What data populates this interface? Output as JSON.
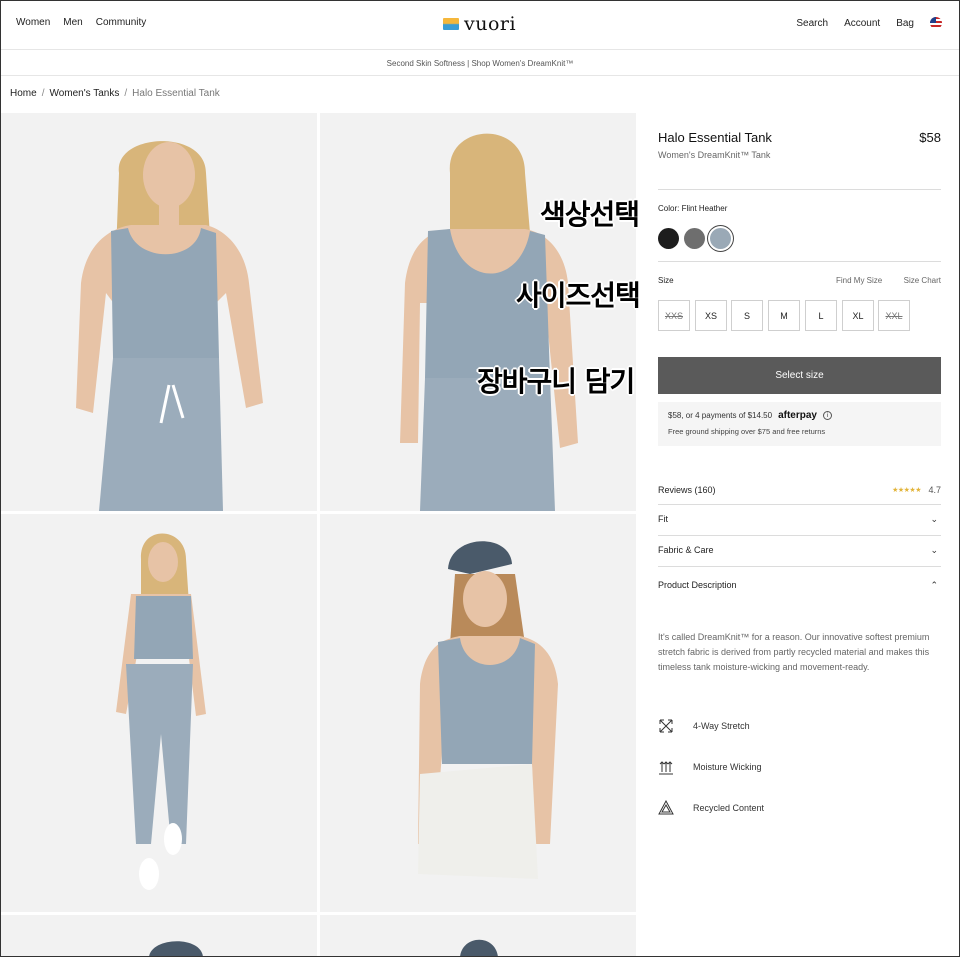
{
  "header": {
    "nav_left": [
      "Women",
      "Men",
      "Community"
    ],
    "logo": "vuori",
    "nav_right": [
      "Search",
      "Account",
      "Bag"
    ]
  },
  "promo": "Second Skin Softness | Shop Women's DreamKnit™",
  "breadcrumb": [
    "Home",
    "Women's Tanks",
    "Halo Essential Tank"
  ],
  "overlays": {
    "color": "색상선택",
    "size": "사이즈선택",
    "cart": "장바구니 담기"
  },
  "product": {
    "title": "Halo Essential Tank",
    "price": "$58",
    "subtitle": "Women's DreamKnit™ Tank",
    "color_label": "Color: Flint Heather",
    "swatches": [
      "#1d1d1d",
      "#6e6e6e",
      "#9aa9b6"
    ],
    "size_label": "Size",
    "find_my_size": "Find My Size",
    "size_chart": "Size Chart",
    "sizes": [
      {
        "label": "XXS",
        "available": false
      },
      {
        "label": "XS",
        "available": true
      },
      {
        "label": "S",
        "available": true
      },
      {
        "label": "M",
        "available": true
      },
      {
        "label": "L",
        "available": true
      },
      {
        "label": "XL",
        "available": true
      },
      {
        "label": "XXL",
        "available": false
      }
    ],
    "cta": "Select size",
    "afterpay_text": "$58, or 4 payments of $14.50",
    "afterpay_logo": "afterpay",
    "afterpay_info": "i",
    "shipping": "Free ground shipping over $75 and free returns",
    "reviews_label": "Reviews (160)",
    "rating": "4.7",
    "rating_value": 4.7,
    "accordion": [
      {
        "label": "Fit",
        "open": false
      },
      {
        "label": "Fabric & Care",
        "open": false
      },
      {
        "label": "Product Description",
        "open": true
      }
    ],
    "description": "It's called DreamKnit™ for a reason. Our innovative softest premium stretch fabric is derived from partly recycled material and makes this timeless tank moisture-wicking and movement-ready.",
    "features": [
      {
        "label": "4-Way Stretch",
        "icon": "stretch-arrows-icon"
      },
      {
        "label": "Moisture Wicking",
        "icon": "moisture-arrows-icon"
      },
      {
        "label": "Recycled Content",
        "icon": "recycle-icon"
      }
    ]
  }
}
